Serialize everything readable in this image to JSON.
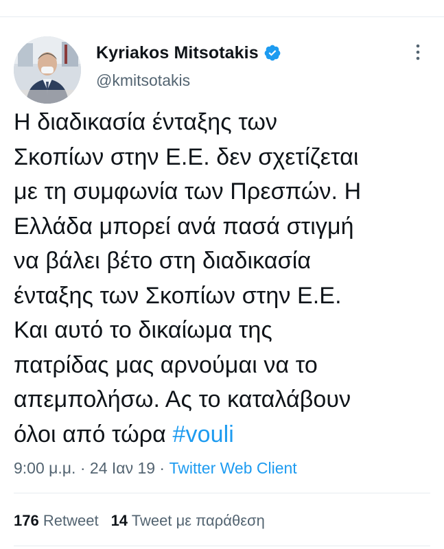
{
  "author": {
    "name": "Kyriakos Mitsotakis",
    "handle": "@kmitsotakis",
    "verified": true,
    "avatar_icon": "profile-photo"
  },
  "tweet": {
    "lines": [
      "Η διαδικασία ένταξης των",
      "Σκοπίων στην Ε.Ε. δεν σχετίζεται",
      "με τη συμφωνία των Πρεσπών. Η",
      "Ελλάδα μπορεί ανά πασά στιγμή",
      "να βάλει βέτο στη διαδικασία",
      "ένταξης των Σκοπίων στην Ε.Ε.",
      "Και αυτό το δικαίωμα της",
      "πατρίδας μας αρνούμαι να το",
      "απεμπολήσω. Ας το καταλάβουν",
      "όλοι από τώρα"
    ],
    "hashtag": "#vouli"
  },
  "meta": {
    "time": "9:00 μ.μ.",
    "separator": " · ",
    "date": "24 Ιαν 19",
    "source": "Twitter Web Client"
  },
  "stats": {
    "retweets_count": "176",
    "retweets_label": "Retweet",
    "quotes_count": "14",
    "quotes_label": "Tweet με παράθεση"
  },
  "colors": {
    "link": "#1d9bf0",
    "secondary_text": "#536471",
    "primary_text": "#0f1419",
    "divider": "#e6ecf0"
  }
}
